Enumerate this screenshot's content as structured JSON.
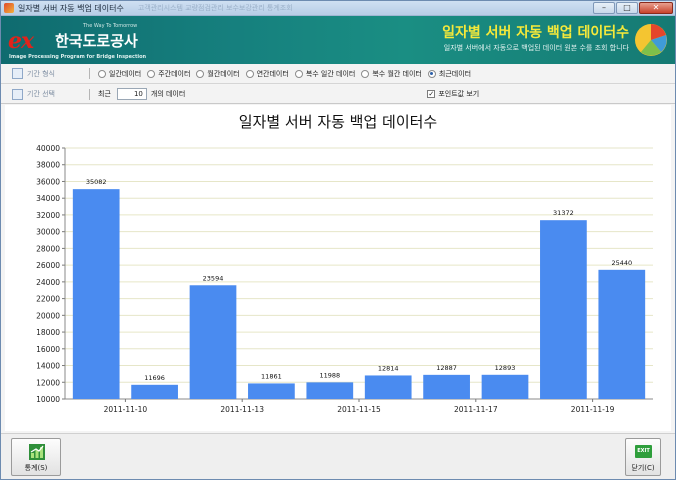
{
  "window": {
    "title": "일자별 서버 자동 백업 데이터수",
    "ghost_text": "고객관리시스템   교량점검관리   보수보강관리   통계조회",
    "minimize_label": "–",
    "maximize_label": "□",
    "close_label": "✕"
  },
  "banner": {
    "logo_mark": "ex",
    "tagline": "The Way To Tomorrow",
    "company": "한국도로공사",
    "subtitle": "Image Processing Program for Bridge Inspection",
    "title": "일자별 서버 자동 백업 데이터수",
    "description": "일자별 서버에서 자동으로 백업된 데이터 원본 수를 조회 합니다"
  },
  "period_type": {
    "label": "기간 형식",
    "options": [
      "일간데이터",
      "주간데이터",
      "월간데이터",
      "연간데이터",
      "복수 일간 데이터",
      "복수 월간 데이터",
      "최근데이터"
    ],
    "selected_index": 6
  },
  "period_select": {
    "label": "기간 선택",
    "recent_prefix": "최근",
    "recent_value": "10",
    "recent_suffix": "개의 데이터",
    "show_points_label": "포인트값 보기",
    "show_points_checked": true
  },
  "chart_data": {
    "type": "bar",
    "title": "일자별 서버 자동 백업 데이터수",
    "values": [
      35082,
      11696,
      23594,
      11861,
      11988,
      12814,
      12887,
      12893,
      31372,
      25440
    ],
    "x_tick_labels": [
      "2011-11-10",
      "2011-11-13",
      "2011-11-15",
      "2011-11-17",
      "2011-11-19"
    ],
    "x_tick_positions": [
      1,
      3,
      5,
      7,
      9
    ],
    "ylim": [
      10000,
      40000
    ],
    "y_ticks": [
      10000,
      12000,
      14000,
      16000,
      18000,
      20000,
      22000,
      24000,
      26000,
      28000,
      30000,
      32000,
      34000,
      36000,
      38000,
      40000
    ],
    "grid": true,
    "bar_color": "#4a8bf0"
  },
  "footer": {
    "stats_label": "통계(S)",
    "close_label": "닫기(C)",
    "exit_icon_text": "EXIT"
  }
}
